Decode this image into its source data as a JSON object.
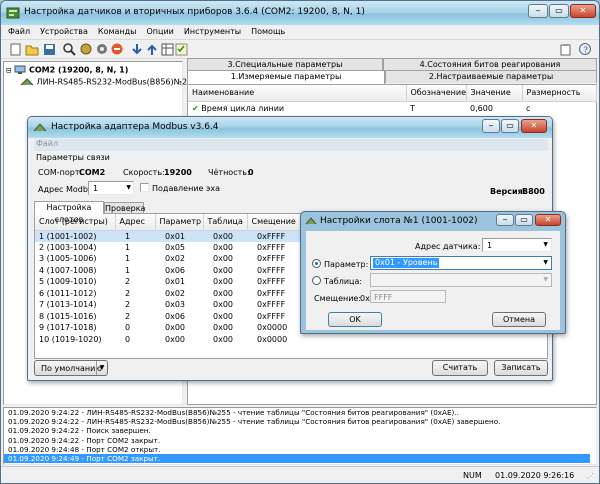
{
  "main": {
    "title": "Настройка датчиков и вторичных приборов 3.6.4 (COM2: 19200, 8, N, 1)",
    "menu": [
      "Файл",
      "Устройства",
      "Команды",
      "Опции",
      "Инструменты",
      "Помощь"
    ],
    "tree": {
      "root": "COM2 (19200, 8, N, 1)",
      "child": "ЛИН-RS485-RS232-ModBus(B856)№255"
    },
    "tabs_top": [
      "3.Специальные параметры",
      "4.Состояния битов реагирования"
    ],
    "tabs_bottom": [
      "1.Измеряемые параметры",
      "2.Настраиваемые параметры"
    ],
    "params_columns": [
      "Наименование",
      "Обозначение",
      "Значение",
      "Размерность"
    ],
    "params_rows": [
      {
        "name": "Время цикла линии",
        "code": "T",
        "value": "0,600",
        "unit": "с"
      }
    ]
  },
  "log": {
    "lines": [
      "01.09.2020 9:24:22 - ЛИН-RS485-RS232-ModBus(B856)№255 - чтение таблицы \"Состояния битов реагирования\" (0xAE)..",
      "01.09.2020 9:24:22 - ЛИН-RS485-RS232-ModBus(B856)№255 - чтение таблицы \"Состояния битов реагирования\" (0xAE) завершено.",
      "01.09.2020 9:24:22 - Поиск завершен.",
      "01.09.2020 9:24:22 - Порт COM2 закрыт.",
      "01.09.2020 9:24:48 - Порт COM2 открыт.",
      "01.09.2020 9:24:49 - Порт COM2 закрыт."
    ]
  },
  "status": {
    "num": "NUM",
    "datetime": "01.09.2020 9:26:16"
  },
  "modbus": {
    "title": "Настройка адаптера Modbus v3.6.4",
    "menu_file": "Файл",
    "group_label": "Параметры связи",
    "port_label": "COM-порт:",
    "port_value": "COM2",
    "speed_label": "Скорость:",
    "speed_value": "19200",
    "parity_label": "Чётность:",
    "parity_value": "0",
    "address_label": "Адрес Modbus:",
    "address_value": "1",
    "echo_label": "Подавление эха",
    "version_label": "Версия:",
    "version_value": "B800",
    "tabs": [
      "Настройка слотов",
      "Проверка"
    ],
    "slot_columns": [
      "Слот (регистры)",
      "Адрес",
      "Параметр",
      "Таблица",
      "Смещение"
    ],
    "slots": [
      [
        "1 (1001-1002)",
        "1",
        "0x01",
        "0x00",
        "0xFFFF"
      ],
      [
        "2 (1003-1004)",
        "1",
        "0x05",
        "0x00",
        "0xFFFF"
      ],
      [
        "3 (1005-1006)",
        "1",
        "0x02",
        "0x00",
        "0xFFFF"
      ],
      [
        "4 (1007-1008)",
        "1",
        "0x06",
        "0x00",
        "0xFFFF"
      ],
      [
        "5 (1009-1010)",
        "2",
        "0x01",
        "0x00",
        "0xFFFF"
      ],
      [
        "6 (1011-1012)",
        "2",
        "0x02",
        "0x00",
        "0xFFFF"
      ],
      [
        "7 (1013-1014)",
        "2",
        "0x03",
        "0x00",
        "0xFFFF"
      ],
      [
        "8 (1015-1016)",
        "2",
        "0x06",
        "0x00",
        "0xFFFF"
      ],
      [
        "9 (1017-1018)",
        "0",
        "0x00",
        "0x00",
        "0x0000"
      ],
      [
        "10 (1019-1020)",
        "0",
        "0x00",
        "0x00",
        "0x0000"
      ]
    ],
    "default_button": "По умолчанию",
    "read_button": "Считать",
    "write_button": "Записать"
  },
  "slot_dialog": {
    "title": "Настройки слота №1 (1001-1002)",
    "address_label": "Адрес датчика:",
    "address_value": "1",
    "param_label": "Параметр:",
    "param_value": "0x01 - Уровень",
    "table_label": "Таблица:",
    "table_value": "",
    "offset_label": "Смещение:",
    "offset_prefix": "0x",
    "offset_value": "FFFF",
    "ok": "OK",
    "cancel": "Отмена"
  }
}
